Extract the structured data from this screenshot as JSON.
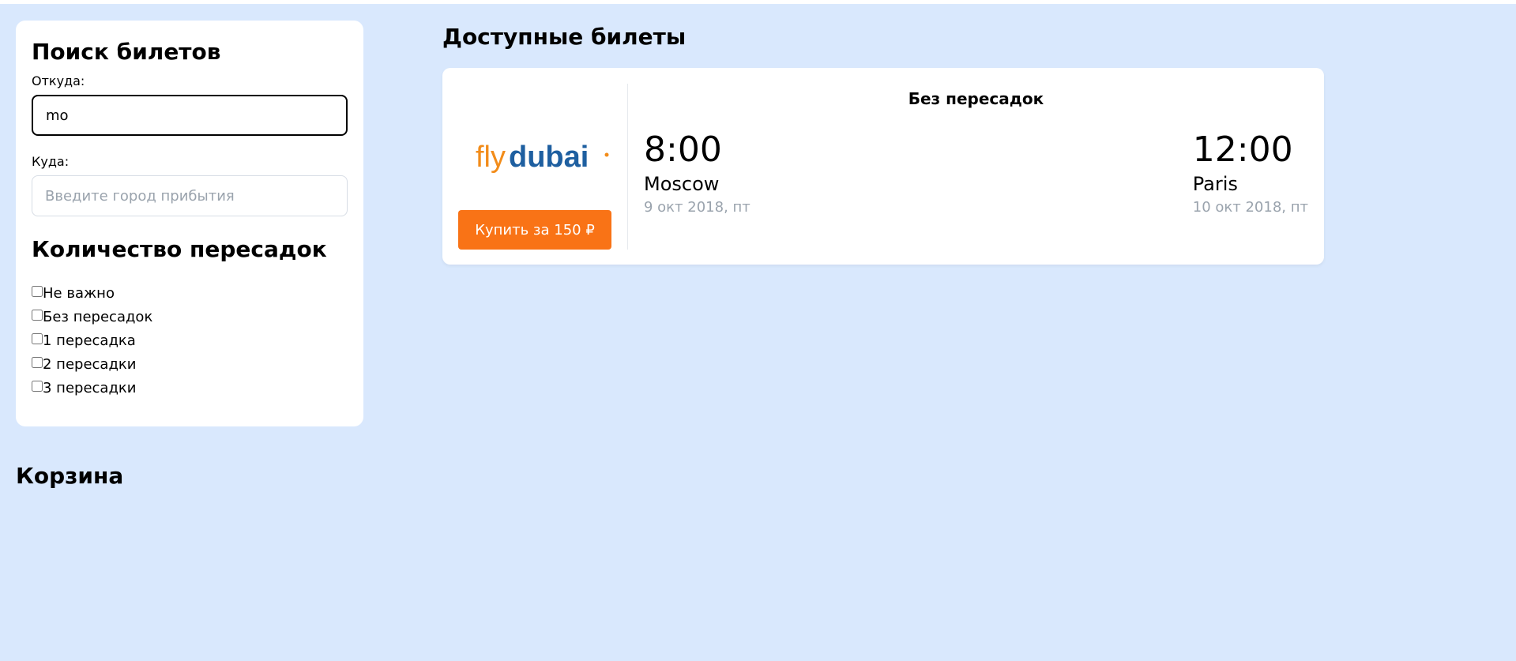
{
  "search": {
    "title": "Поиск билетов",
    "from_label": "Откуда:",
    "from_value": "mo",
    "to_label": "Куда:",
    "to_placeholder": "Введите город прибытия",
    "to_value": "",
    "stops_title": "Количество пересадок",
    "stops_options": [
      {
        "label": "Не важно",
        "checked": false
      },
      {
        "label": "Без пересадок",
        "checked": false
      },
      {
        "label": "1 пересадка",
        "checked": false
      },
      {
        "label": "2 пересадки",
        "checked": false
      },
      {
        "label": "3 пересадки",
        "checked": false
      }
    ]
  },
  "cart": {
    "title": "Корзина"
  },
  "tickets": {
    "title": "Доступные билеты",
    "items": [
      {
        "airline": "flydubai",
        "airline_logo_parts": [
          "fly",
          "dubai"
        ],
        "buy_label": "Купить за 150 ₽",
        "stops_label": "Без пересадок",
        "departure": {
          "time": "8:00",
          "city": "Moscow",
          "date": "9 окт 2018, пт"
        },
        "arrival": {
          "time": "12:00",
          "city": "Paris",
          "date": "10 окт 2018, пт"
        }
      }
    ]
  },
  "colors": {
    "page_background": "#d9e8fd",
    "accent_orange": "#f97316",
    "logo_blue": "#1e5fa0",
    "logo_orange": "#f28c1a"
  }
}
